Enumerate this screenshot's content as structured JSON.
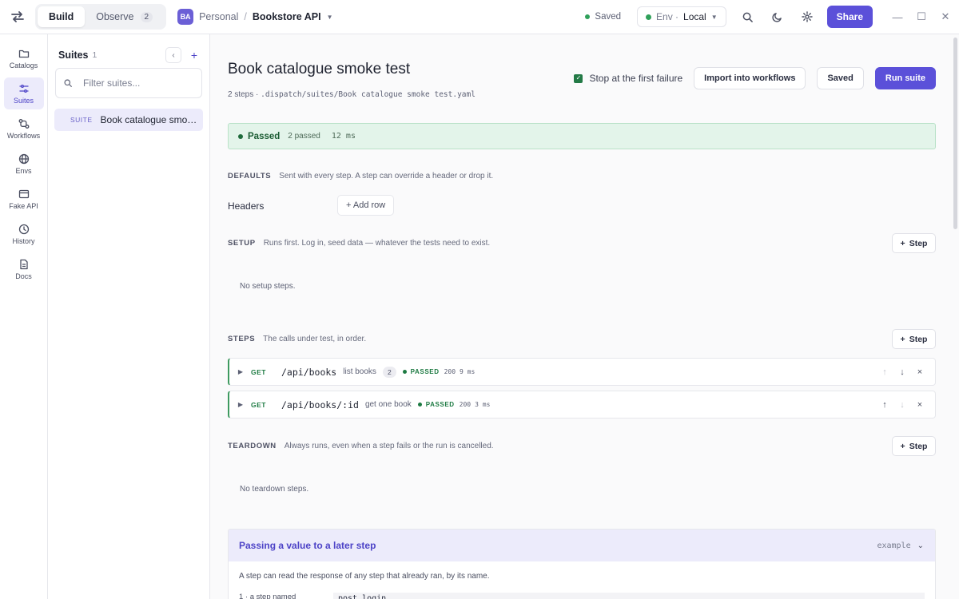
{
  "topbar": {
    "modes": [
      {
        "label": "Build",
        "active": true
      },
      {
        "label": "Observe",
        "count": "2",
        "active": false
      }
    ],
    "workspace_avatar": "BA",
    "workspace": "Personal",
    "separator": "/",
    "project": "Bookstore API",
    "saved_status": "Saved",
    "env_label": "Env ·",
    "env_value": "Local",
    "share_label": "Share"
  },
  "rail": [
    {
      "label": "Catalogs",
      "icon": "folder-icon"
    },
    {
      "label": "Suites",
      "icon": "sliders-icon",
      "active": true
    },
    {
      "label": "Workflows",
      "icon": "workflow-icon"
    },
    {
      "label": "Envs",
      "icon": "globe-icon"
    },
    {
      "label": "Fake API",
      "icon": "server-icon"
    },
    {
      "label": "History",
      "icon": "clock-icon"
    },
    {
      "label": "Docs",
      "icon": "document-icon"
    }
  ],
  "suites": {
    "title": "Suites",
    "count": "1",
    "filter_placeholder": "Filter suites...",
    "items": [
      {
        "tag": "SUITE",
        "name": "Book catalogue smoke test"
      }
    ]
  },
  "main": {
    "title": "Book catalogue smoke test",
    "meta_steps": "2 steps ·",
    "meta_path": ".dispatch/suites/Book catalogue smoke test.yaml",
    "stop_on_failure_label": "Stop at the first failure",
    "import_label": "Import into workflows",
    "saved_label": "Saved",
    "run_label": "Run suite",
    "result": {
      "status": "Passed",
      "count": "2 passed",
      "time": "12 ms"
    },
    "defaults": {
      "label": "DEFAULTS",
      "desc": "Sent with every step. A step can override a header or drop it.",
      "headers_label": "Headers",
      "add_row": "+ Add row"
    },
    "setup": {
      "label": "SETUP",
      "desc": "Runs first. Log in, seed data — whatever the tests need to exist.",
      "empty": "No setup steps."
    },
    "steps": {
      "label": "STEPS",
      "desc": "The calls under test, in order.",
      "items": [
        {
          "method": "GET",
          "path": "/api/books",
          "name": "list books",
          "badge": "2",
          "status": "PASSED",
          "code": "200",
          "time": "9 ms"
        },
        {
          "method": "GET",
          "path": "/api/books/:id",
          "name": "get one book",
          "status": "PASSED",
          "code": "200",
          "time": "3 ms"
        }
      ]
    },
    "teardown": {
      "label": "TEARDOWN",
      "desc": "Always runs, even when a step fails or the run is cancelled.",
      "empty": "No teardown steps."
    },
    "step_button": "Step",
    "example": {
      "title": "Passing a value to a later step",
      "tag": "example",
      "body": "A step can read the response of any step that already ran, by its name.",
      "line_key": "1 · a step named",
      "line_value": "post login"
    }
  }
}
